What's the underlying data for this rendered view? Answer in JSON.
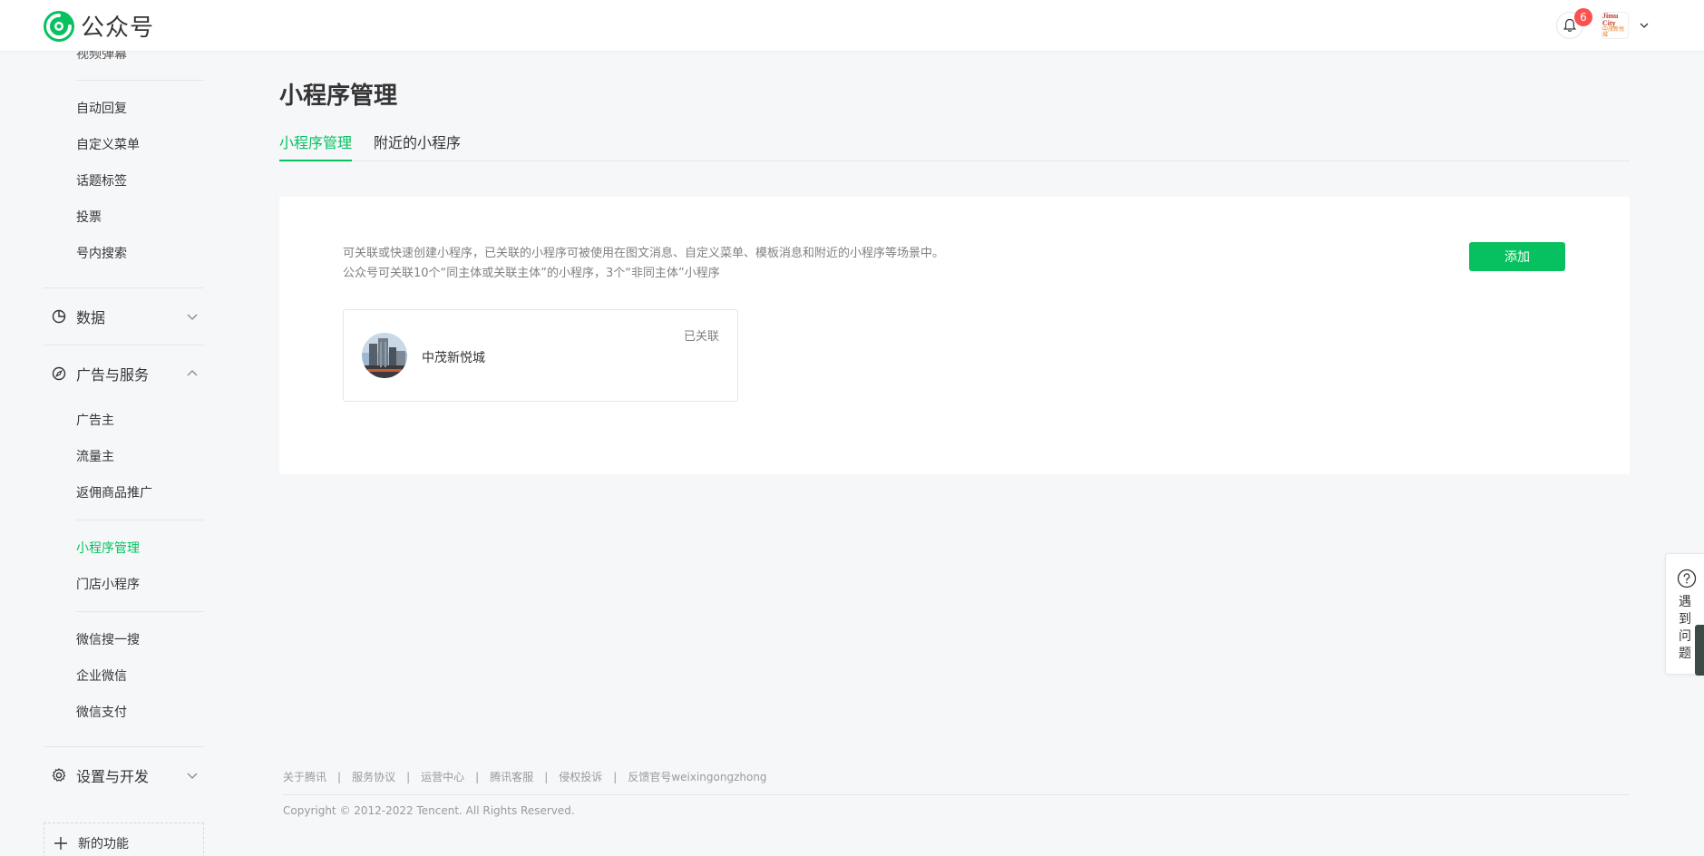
{
  "header": {
    "logo_text": "公众号",
    "notification_count": "6",
    "account_avatar_text_top": "Jimu City",
    "account_avatar_text_bottom": "中茂新悦城"
  },
  "sidebar": {
    "clipped_item": "视频弹幕",
    "items_interaction": [
      "自动回复",
      "自定义菜单",
      "话题标签",
      "投票",
      "号内搜索"
    ],
    "group_data": "数据",
    "group_ads": "广告与服务",
    "items_ads_a": [
      "广告主",
      "流量主",
      "返佣商品推广"
    ],
    "items_ads_b": [
      "小程序管理",
      "门店小程序"
    ],
    "items_ads_c": [
      "微信搜一搜",
      "企业微信",
      "微信支付"
    ],
    "group_settings": "设置与开发",
    "new_features": "新的功能",
    "active_item": "小程序管理"
  },
  "main": {
    "title": "小程序管理",
    "tabs": [
      "小程序管理",
      "附近的小程序"
    ],
    "desc_line1": "可关联或快速创建小程序，已关联的小程序可被使用在图文消息、自定义菜单、模板消息和附近的小程序等场景中。",
    "desc_line2": "公众号可关联10个“同主体或关联主体”的小程序，3个“非同主体”小程序",
    "add_label": "添加",
    "miniprogram": {
      "name": "中茂新悦城",
      "status": "已关联"
    }
  },
  "footer": {
    "links": [
      "关于腾讯",
      "服务协议",
      "运营中心",
      "腾讯客服",
      "侵权投诉",
      "反馈官号weixingongzhong"
    ],
    "separator": "|",
    "copyright": "Copyright © 2012-2022 Tencent. All Rights Reserved."
  },
  "help": {
    "label": "遇到问题"
  },
  "colors": {
    "accent": "#07c160",
    "badge": "#fa5151",
    "background": "#f6f7f9"
  }
}
